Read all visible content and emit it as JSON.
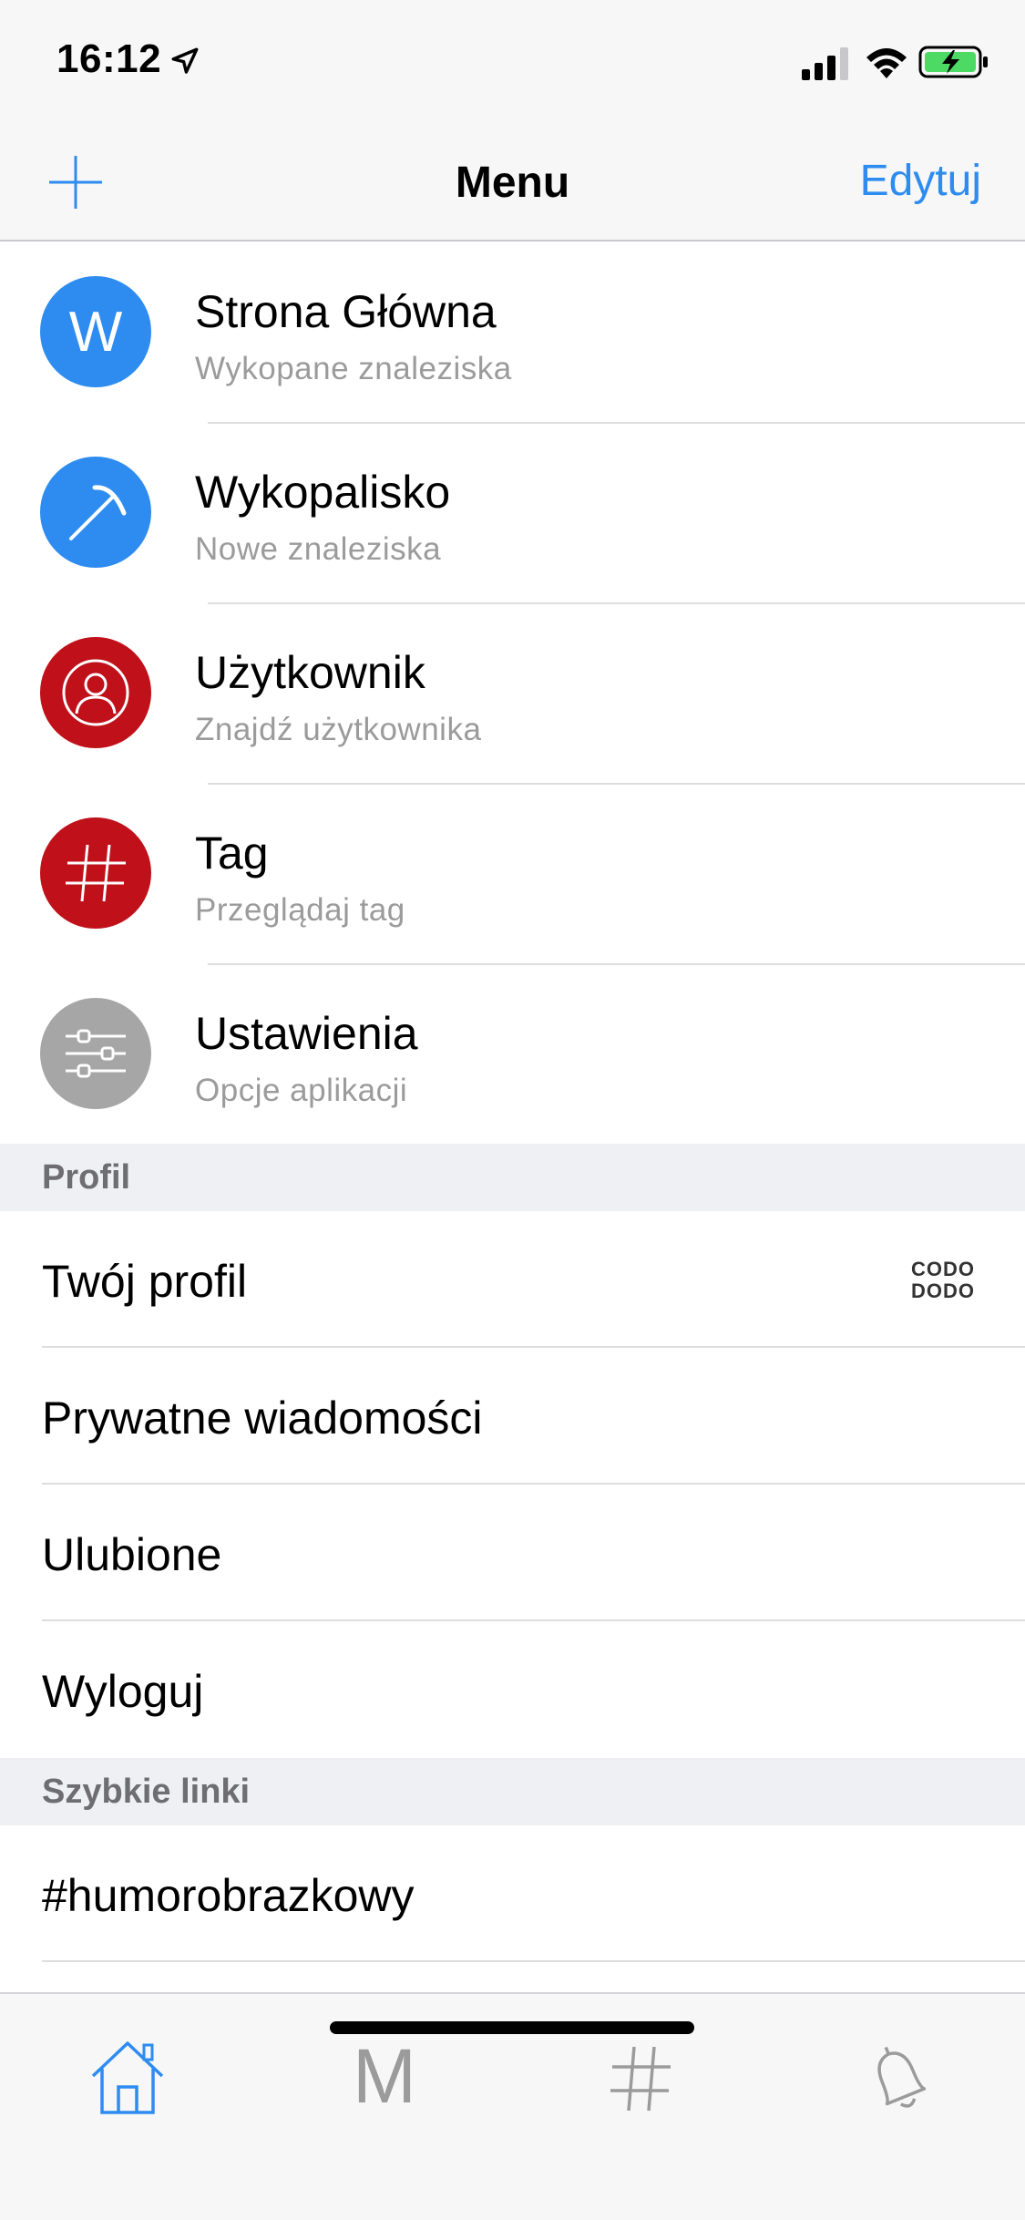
{
  "status_bar": {
    "time": "16:12",
    "icons": [
      "location-arrow-icon",
      "cellular-signal-icon",
      "wifi-icon",
      "battery-charging-icon"
    ],
    "battery_color": "#4cd964"
  },
  "nav_bar": {
    "title": "Menu",
    "edit_label": "Edytuj",
    "add_icon": "plus-icon",
    "accent_color": "#2e8cf0"
  },
  "menu": {
    "items": [
      {
        "title": "Strona Główna",
        "subtitle": "Wykopane znaleziska",
        "icon": "w-letter-icon",
        "color": "#2e8cf0"
      },
      {
        "title": "Wykopalisko",
        "subtitle": "Nowe znaleziska",
        "icon": "pickaxe-icon",
        "color": "#2e8cf0"
      },
      {
        "title": "Użytkownik",
        "subtitle": "Znajdź użytkownika",
        "icon": "user-icon",
        "color": "#c0111b"
      },
      {
        "title": "Tag",
        "subtitle": "Przeglądaj tag",
        "icon": "hashtag-icon",
        "color": "#c0111b"
      },
      {
        "title": "Ustawienia",
        "subtitle": "Opcje aplikacji",
        "icon": "sliders-icon",
        "color": "#a6a6a6"
      }
    ]
  },
  "profile_section": {
    "header": "Profil",
    "items": [
      "Twój profil",
      "Prywatne wiadomości",
      "Ulubione",
      "Wyloguj"
    ],
    "badge_line1": "CODO",
    "badge_line2": "DODO"
  },
  "quick_links_section": {
    "header": "Szybkie linki",
    "items": [
      "#humorobrazkowy"
    ]
  },
  "tab_bar": {
    "tabs": [
      {
        "name": "home",
        "icon": "home-icon",
        "active": true
      },
      {
        "name": "mikroblog",
        "icon": "m-letter-icon",
        "label": "M",
        "active": false
      },
      {
        "name": "tags",
        "icon": "hashtag-icon",
        "active": false
      },
      {
        "name": "notifications",
        "icon": "bell-icon",
        "active": false
      }
    ],
    "active_color": "#2e8cf0",
    "inactive_color": "#9b9b9b"
  }
}
